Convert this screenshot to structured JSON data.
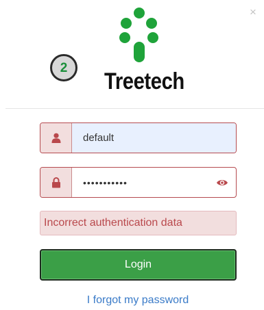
{
  "window": {
    "close_label": "×"
  },
  "branding": {
    "name": "Treetech",
    "logo_icon": "tree-dots-logo",
    "accent_color": "#1fa33a"
  },
  "step_badge": {
    "number": "2"
  },
  "form": {
    "username": {
      "value": "default",
      "icon": "user-icon"
    },
    "password": {
      "masked_value": "•••••••••••",
      "icon": "lock-icon",
      "toggle_icon": "eye-icon"
    },
    "error": {
      "text": "Incorrect authentication data",
      "color": "#b9484c"
    },
    "login_label": "Login",
    "forgot_label": "I forgot my password"
  }
}
